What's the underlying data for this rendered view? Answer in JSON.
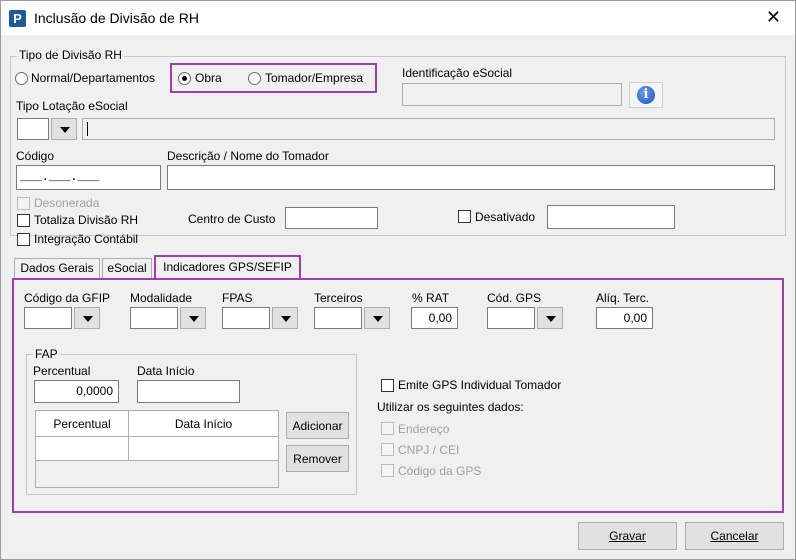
{
  "window": {
    "title": "Inclusão de Divisão de RH"
  },
  "tipo": {
    "legend": "Tipo de Divisão RH",
    "options": [
      "Normal/Departamentos",
      "Obra",
      "Tomador/Empresa"
    ],
    "selected": "Obra"
  },
  "esocial_id": {
    "label": "Identificação eSocial",
    "value": ""
  },
  "lotacao": {
    "label": "Tipo Lotação eSocial",
    "code": "",
    "desc": ""
  },
  "codigo": {
    "label": "Código",
    "mask": "___.___.___"
  },
  "descricao": {
    "label": "Descrição / Nome do Tomador",
    "value": ""
  },
  "flags": {
    "desonerada": "Desonerada",
    "totaliza": "Totaliza Divisão RH",
    "integracao": "Integração Contábil",
    "desativado": "Desativado"
  },
  "centro_custo": {
    "label": "Centro de Custo",
    "value": ""
  },
  "tabs": [
    "Dados Gerais",
    "eSocial",
    "Indicadores GPS/SEFIP"
  ],
  "active_tab": "Indicadores GPS/SEFIP",
  "gps": {
    "codigo_gfip": "Código da GFIP",
    "modalidade": "Modalidade",
    "fpas": "FPAS",
    "terceiros": "Terceiros",
    "rat_label": "% RAT",
    "rat_value": "0,00",
    "cod_gps": "Cód. GPS",
    "aliq_label": "Alíq. Terc.",
    "aliq_value": "0,00"
  },
  "fap": {
    "legend": "FAP",
    "percentual_label": "Percentual",
    "percentual_value": "0,0000",
    "data_label": "Data Início",
    "grid_headers": [
      "Percentual",
      "Data Início"
    ],
    "add": "Adicionar",
    "remove": "Remover"
  },
  "emite": {
    "label": "Emite GPS Individual Tomador",
    "utilizar": "Utilizar os seguintes dados:",
    "items": [
      "Endereço",
      "CNPJ / CEI",
      "Código da GPS"
    ]
  },
  "buttons": {
    "gravar": "Gravar",
    "cancelar": "Cancelar"
  },
  "colors": {
    "highlight": "#9b3fb0",
    "info": "#1d4fc2"
  }
}
